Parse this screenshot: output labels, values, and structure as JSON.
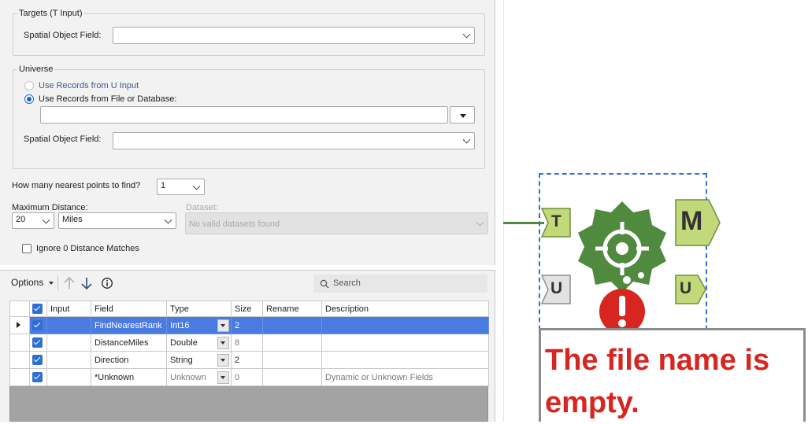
{
  "targets": {
    "legend": "Targets (T Input)",
    "spatial_field_label": "Spatial Object Field:",
    "spatial_field_value": ""
  },
  "universe": {
    "legend": "Universe",
    "option_u_input": "Use Records from U Input",
    "option_file": "Use Records from File or Database:",
    "selected_option": "file",
    "file_path_value": "",
    "spatial_field_label": "Spatial Object Field:",
    "spatial_field_value": ""
  },
  "nearest": {
    "label": "How many nearest points to find?",
    "value": "1"
  },
  "max_distance": {
    "label": "Maximum Distance:",
    "value": "20",
    "units": "Miles"
  },
  "dataset": {
    "label": "Dataset:",
    "value": "No valid datasets found"
  },
  "ignore_zero": {
    "label": "Ignore 0 Distance Matches",
    "checked": false
  },
  "toolbar": {
    "options_label": "Options",
    "search_placeholder": "Search"
  },
  "table": {
    "columns": [
      "Input",
      "Field",
      "Type",
      "Size",
      "Rename",
      "Description"
    ],
    "rows": [
      {
        "selected": true,
        "input": "",
        "field": "FindNearestRank",
        "type": "Int16",
        "size": "2",
        "rename": "",
        "description": "",
        "dim": false
      },
      {
        "selected": false,
        "input": "",
        "field": "DistanceMiles",
        "type": "Double",
        "size": "8",
        "rename": "",
        "description": "",
        "dim": false
      },
      {
        "selected": false,
        "input": "",
        "field": "Direction",
        "type": "String",
        "size": "2",
        "rename": "",
        "description": "",
        "dim": false
      },
      {
        "selected": false,
        "input": "",
        "field": "*Unknown",
        "type": "Unknown",
        "size": "0",
        "rename": "",
        "description": "Dynamic or Unknown Fields",
        "dim": true
      }
    ]
  },
  "canvas": {
    "anchor_t": "T",
    "anchor_u_in": "U",
    "anchor_m": "M",
    "anchor_u_out": "U",
    "error_message": "The file name is empty.",
    "colors": {
      "tool_green": "#4f8a3f",
      "anchor_green": "#c2d97a",
      "anchor_gray": "#e3e3e3",
      "error_red": "#d7261f",
      "selection_blue": "#3a6fd8"
    }
  }
}
